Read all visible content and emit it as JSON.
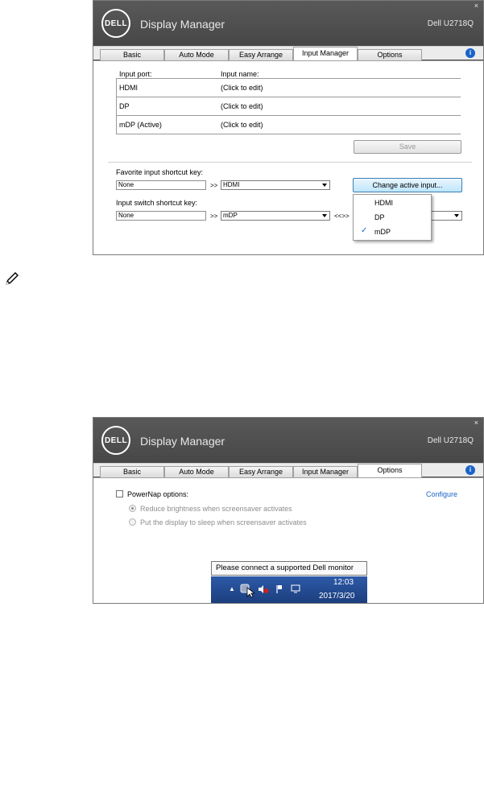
{
  "window1": {
    "logo_text": "DELL",
    "app_title": "Display Manager",
    "model": "Dell U2718Q",
    "close_glyph": "×",
    "tabs": [
      "Basic",
      "Auto Mode",
      "Easy Arrange",
      "Input Manager",
      "Options"
    ],
    "active_tab": "Input Manager",
    "info_glyph": "i",
    "col_port": "Input port:",
    "col_name": "Input name:",
    "ports": [
      {
        "port": "HDMI",
        "name": "(Click to edit)"
      },
      {
        "port": "DP",
        "name": "(Click to edit)"
      },
      {
        "port": "mDP (Active)",
        "name": "(Click to edit)"
      }
    ],
    "save_label": "Save",
    "favorite_label": "Favorite input shortcut key:",
    "favorite_value": "None",
    "favorite_arrow": ">>",
    "favorite_select": "HDMI",
    "change_active_label": "Change active input...",
    "switch_label": "Input switch shortcut key:",
    "switch_value": "None",
    "switch_arrow": ">>",
    "switch_select": "mDP",
    "switch_swap": "<<>>",
    "dropdown_items": [
      "HDMI",
      "DP",
      "mDP"
    ],
    "dropdown_checked": "mDP",
    "check_glyph": "✓"
  },
  "window2": {
    "logo_text": "DELL",
    "app_title": "Display Manager",
    "model": "Dell U2718Q",
    "close_glyph": "×",
    "tabs": [
      "Basic",
      "Auto Mode",
      "Easy Arrange",
      "Input Manager",
      "Options"
    ],
    "active_tab": "Options",
    "info_glyph": "i",
    "powernap_label": "PowerNap options:",
    "configure_label": "Configure",
    "radio1_label": "Reduce brightness when screensaver activates",
    "radio2_label": "Put the display to sleep when screensaver activates"
  },
  "taskbar": {
    "tooltip": "Please connect a supported Dell monitor",
    "time": "12:03",
    "date": "2017/3/20",
    "expand_glyph": "▲"
  },
  "colors": {
    "titlebar": "#4b4b4b",
    "accent_blue": "#1a63c9",
    "taskbar_blue": "#2d5aa8"
  }
}
